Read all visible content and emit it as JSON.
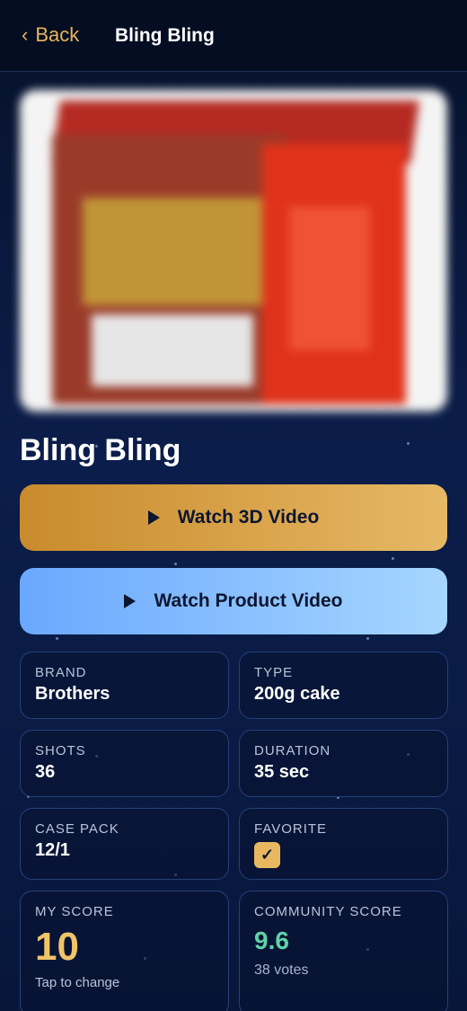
{
  "header": {
    "back_label": "Back",
    "back_icon": "chevron-left",
    "title": "Bling Bling"
  },
  "product": {
    "name": "Bling Bling"
  },
  "buttons": {
    "watch_3d": "Watch 3D Video",
    "watch_product": "Watch Product Video"
  },
  "details": {
    "brand": {
      "label": "BRAND",
      "value": "Brothers"
    },
    "type": {
      "label": "TYPE",
      "value": "200g cake"
    },
    "shots": {
      "label": "SHOTS",
      "value": "36"
    },
    "duration": {
      "label": "DURATION",
      "value": "35 sec"
    },
    "case_pack": {
      "label": "CASE PACK",
      "value": "12/1"
    },
    "favorite": {
      "label": "FAVORITE",
      "checked": true,
      "check_glyph": "✓"
    }
  },
  "scores": {
    "my_score": {
      "label": "MY SCORE",
      "value": "10",
      "hint": "Tap to change"
    },
    "community": {
      "label": "COMMUNITY SCORE",
      "value": "9.6",
      "votes": "38 votes"
    }
  },
  "colors": {
    "accent_gold": "#e9b45a",
    "accent_blue": "#8cc4ff",
    "score_green": "#5fd3a8",
    "background": "#0b1d4a"
  }
}
